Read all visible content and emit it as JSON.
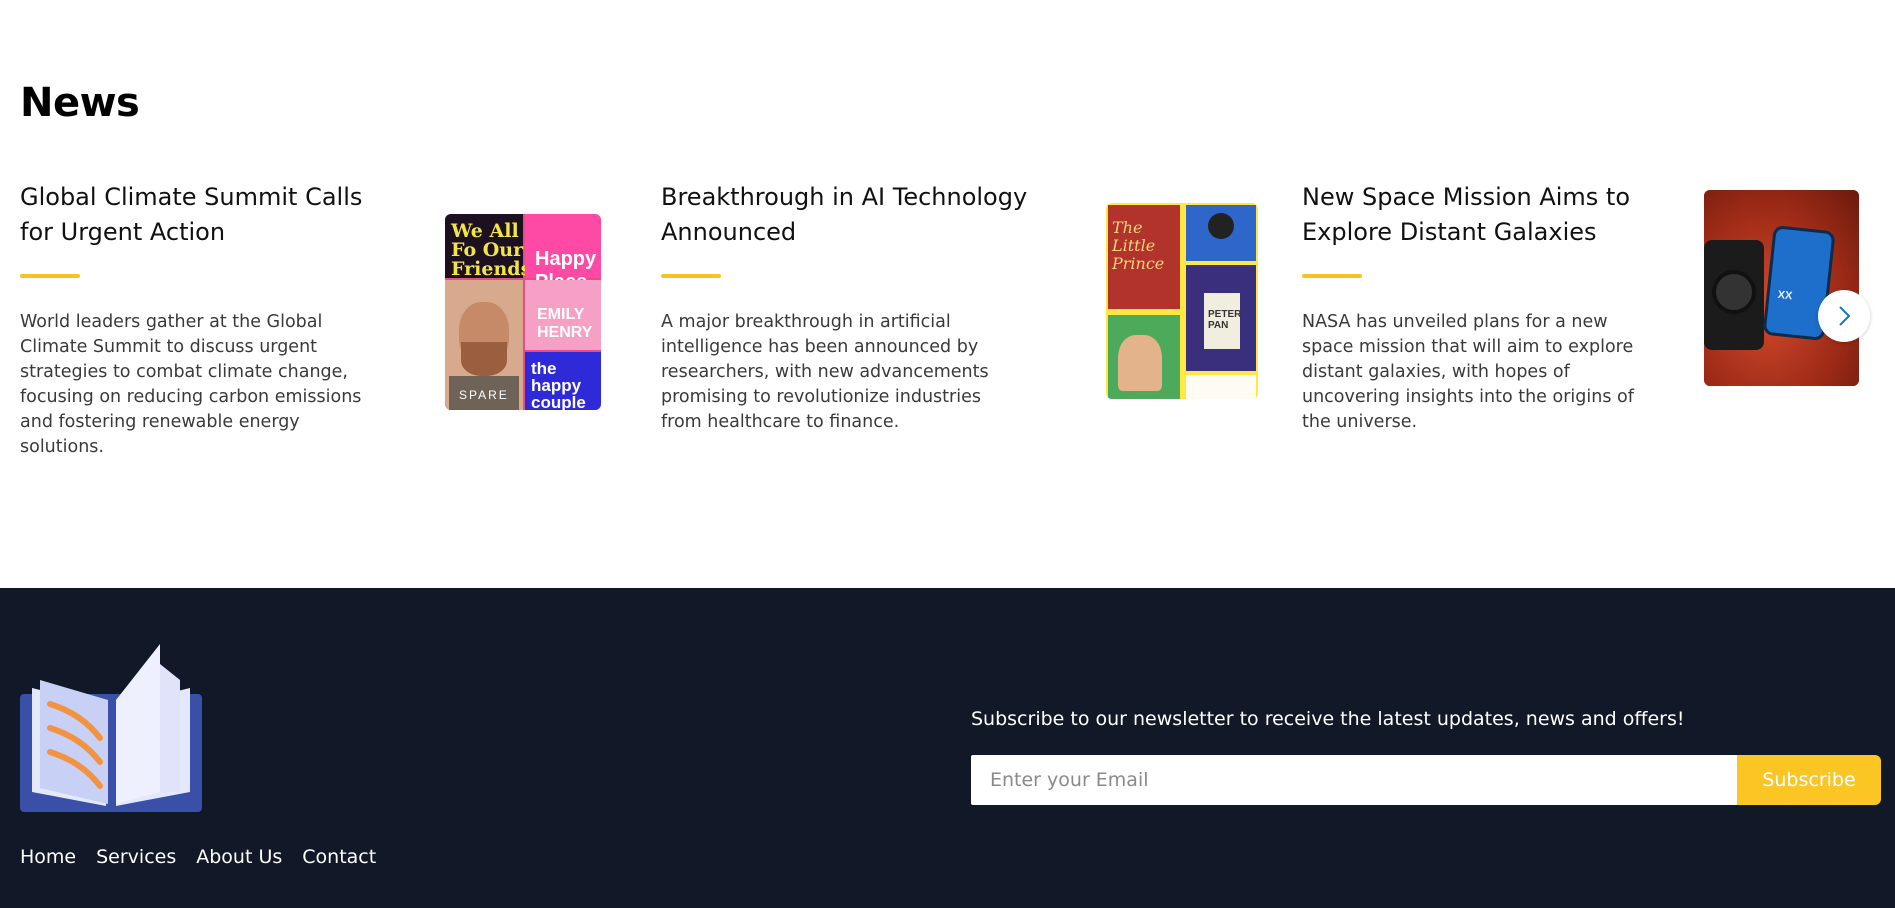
{
  "news": {
    "title": "News",
    "articles": [
      {
        "title": "Global Climate Summit Calls for Urgent Action",
        "body": "World leaders gather at the Global Climate Summit to discuss urgent strategies to combat climate change, focusing on reducing carbon emissions and fostering renewable energy solutions.",
        "image_text": [
          "We All Fo Our Friends",
          "Happy Place",
          "SPARE",
          "EMILY HENRY",
          "the happy couple"
        ]
      },
      {
        "title": "Breakthrough in AI Technology Announced",
        "body": "A major breakthrough in artificial intelligence has been announced by researchers, with new advancements promising to revolutionize industries from healthcare to finance.",
        "image_text": [
          "The Little Prince",
          "PETER PAN"
        ]
      },
      {
        "title": "New Space Mission Aims to Explore Distant Galaxies",
        "body": "NASA has unveiled plans for a new space mission that will aim to explore distant galaxies, with hopes of uncovering insights into the origins of the universe.",
        "image_text": [
          "XX"
        ]
      }
    ],
    "next_icon": "chevron-right-icon"
  },
  "footer": {
    "logo_icon": "open-book-icon",
    "nav": [
      "Home",
      "Services",
      "About Us",
      "Contact"
    ],
    "newsletter_text": "Subscribe to our newsletter to receive the latest updates, news and offers!",
    "email_placeholder": "Enter your Email",
    "subscribe_label": "Subscribe"
  },
  "colors": {
    "accent": "#fbc524",
    "footer_bg": "#111827",
    "slider_arrow": "#1e73be"
  }
}
